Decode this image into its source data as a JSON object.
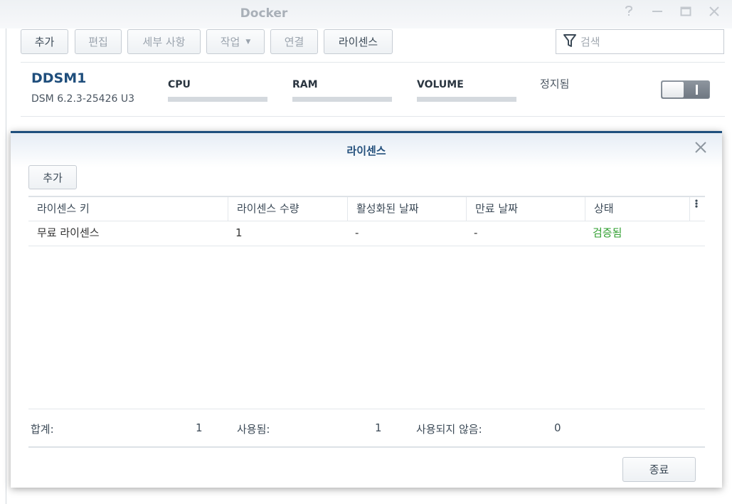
{
  "window": {
    "title": "Docker",
    "controls": [
      "help-icon",
      "minimize-icon",
      "maximize-icon",
      "close-icon"
    ]
  },
  "toolbar": {
    "add": "추가",
    "edit": "편집",
    "details": "세부 사항",
    "action": "작업",
    "connect": "연결",
    "license": "라이센스",
    "search_placeholder": "검색"
  },
  "container": {
    "name": "DDSM1",
    "version": "DSM 6.2.3-25426 U3",
    "metrics": [
      "CPU",
      "RAM",
      "VOLUME"
    ],
    "status": "정지됨",
    "toggle_on": false
  },
  "modal": {
    "title": "라이센스",
    "add": "추가",
    "columns": [
      "라이센스 키",
      "라이센스 수량",
      "활성화된 날짜",
      "만료 날짜",
      "상태"
    ],
    "rows": [
      [
        "무료 라이센스",
        "1",
        "-",
        "-",
        "검증됨"
      ]
    ],
    "summary": {
      "total_label": "합계:",
      "total_value": "1",
      "used_label": "사용됨:",
      "used_value": "1",
      "unused_label": "사용되지 않음:",
      "unused_value": "0"
    },
    "close": "종료"
  },
  "colors": {
    "accent": "#1e4f7d",
    "status_ok": "#2e9e2e"
  }
}
